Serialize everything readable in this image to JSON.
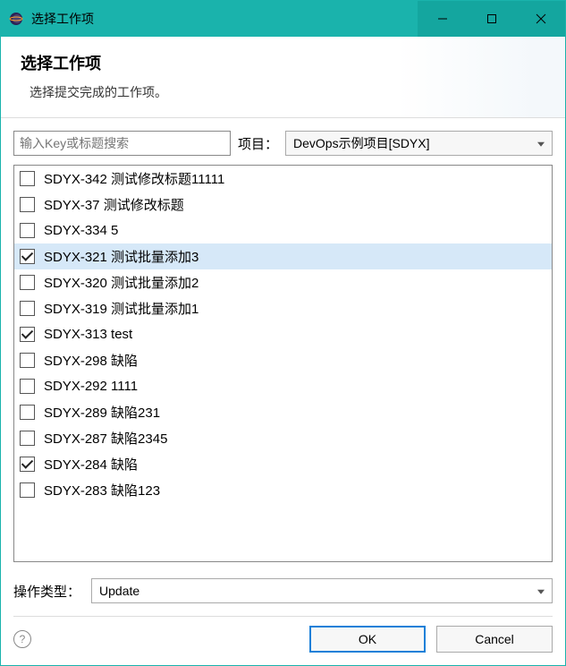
{
  "window": {
    "title": "选择工作项"
  },
  "header": {
    "title": "选择工作项",
    "subtitle": "选择提交完成的工作项。"
  },
  "search": {
    "placeholder": "输入Key或标题搜索",
    "value": ""
  },
  "project": {
    "label": "项目：",
    "selected": "DevOps示例项目[SDYX]"
  },
  "items": [
    {
      "key": "SDYX-342",
      "title": "测试修改标题11111",
      "checked": false,
      "selected": false
    },
    {
      "key": "SDYX-37",
      "title": "测试修改标题",
      "checked": false,
      "selected": false
    },
    {
      "key": "SDYX-334",
      "title": "5",
      "checked": false,
      "selected": false
    },
    {
      "key": "SDYX-321",
      "title": "测试批量添加3",
      "checked": true,
      "selected": true
    },
    {
      "key": "SDYX-320",
      "title": "测试批量添加2",
      "checked": false,
      "selected": false
    },
    {
      "key": "SDYX-319",
      "title": "测试批量添加1",
      "checked": false,
      "selected": false
    },
    {
      "key": "SDYX-313",
      "title": "test",
      "checked": true,
      "selected": false
    },
    {
      "key": "SDYX-298",
      "title": "缺陷",
      "checked": false,
      "selected": false
    },
    {
      "key": "SDYX-292",
      "title": "1111",
      "checked": false,
      "selected": false
    },
    {
      "key": "SDYX-289",
      "title": "缺陷231",
      "checked": false,
      "selected": false
    },
    {
      "key": "SDYX-287",
      "title": "缺陷2345",
      "checked": false,
      "selected": false
    },
    {
      "key": "SDYX-284",
      "title": "缺陷",
      "checked": true,
      "selected": false
    },
    {
      "key": "SDYX-283",
      "title": "缺陷123",
      "checked": false,
      "selected": false
    }
  ],
  "operation": {
    "label": "操作类型：",
    "selected": "Update"
  },
  "buttons": {
    "ok": "OK",
    "cancel": "Cancel"
  }
}
